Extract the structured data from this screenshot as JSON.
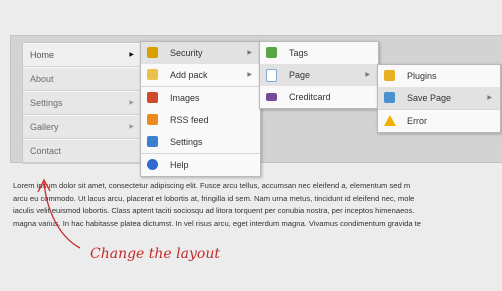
{
  "nav": {
    "items": [
      {
        "label": "Home",
        "arrow": "▶"
      },
      {
        "label": "About",
        "arrow": ""
      },
      {
        "label": "Settings",
        "arrow": "▶"
      },
      {
        "label": "Gallery",
        "arrow": "▶"
      },
      {
        "label": "Contact",
        "arrow": ""
      }
    ]
  },
  "menu1": {
    "items": [
      {
        "label": "Security",
        "icon": "lock-icon",
        "arrow": "▶"
      },
      {
        "label": "Add pack",
        "icon": "folder-add-icon",
        "arrow": "▶"
      },
      {
        "label": "Images",
        "icon": "image-icon",
        "arrow": ""
      },
      {
        "label": "RSS feed",
        "icon": "rss-icon",
        "arrow": ""
      },
      {
        "label": "Settings",
        "icon": "monitor-icon",
        "arrow": ""
      },
      {
        "label": "Help",
        "icon": "help-icon",
        "arrow": ""
      }
    ]
  },
  "menu2": {
    "items": [
      {
        "label": "Tags",
        "icon": "tags-icon",
        "arrow": ""
      },
      {
        "label": "Page",
        "icon": "page-icon",
        "arrow": "▶"
      },
      {
        "label": "Creditcard",
        "icon": "creditcard-icon",
        "arrow": ""
      }
    ]
  },
  "menu3": {
    "items": [
      {
        "label": "Plugins",
        "icon": "puzzle-icon",
        "arrow": ""
      },
      {
        "label": "Save Page",
        "icon": "save-page-icon",
        "arrow": "▶"
      },
      {
        "label": "Error",
        "icon": "warning-icon",
        "arrow": ""
      }
    ]
  },
  "content": {
    "lines": [
      "Lorem ipsum dolor sit amet, consectetur adipiscing elit. Fusce arcu tellus, accumsan nec eleifend a, elementum sed m",
      "arcu eu commodo. Ut lacus arcu, placerat et lobortis at, fringilla id sem. Nam urna metus, tincidunt id eleifend nec, mole",
      "iaculis velit euismod lobortis. Class aptent taciti sociosqu ad litora torquent per conubia nostra, per inceptos himenaeos.",
      "magna varius. In hac habitasse platea dictumst. In vel risus arcu, eget interdum magna. Vivamus condimentum gravida te"
    ],
    "annotation": "Change the layout"
  }
}
